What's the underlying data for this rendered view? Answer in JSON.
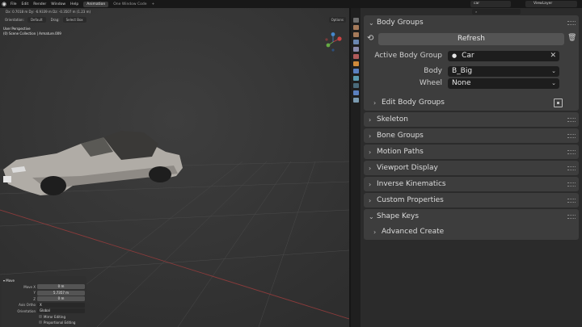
{
  "topbar": {
    "menus": [
      "File",
      "Edit",
      "Render",
      "Window",
      "Help"
    ],
    "workspace_tabs": [
      {
        "label": "Animation",
        "active": true
      },
      {
        "label": "One Window Code",
        "active": false
      }
    ],
    "scene_search": "car",
    "view_layer": "ViewLayer"
  },
  "viewport": {
    "status_text": "Dx: 0.7018 m   Dy: -6.9339 m   Dz: -0.3507 m (1.23 m)",
    "orientation_label": "Orientation:",
    "orientation_value": "Default",
    "drag_label": "Drag:",
    "drag_value": "Select Box",
    "options_label": "Options",
    "view_name": "User Perspective",
    "collection_info": "(0) Scene Collection | Armature.009"
  },
  "move_panel": {
    "title": "Move",
    "fields": [
      {
        "label": "Move X",
        "value": "0 m"
      },
      {
        "label": "Y",
        "value": "5.7357 m"
      },
      {
        "label": "Z",
        "value": "0 m"
      }
    ],
    "axis_ortho_label": "Axis Ortho",
    "axis_ortho_value": "X",
    "orientation_label": "Orientation",
    "orientation_value": "Global",
    "mirror_editing": "Mirror Editing",
    "proportional_editing": "Proportional Editing"
  },
  "properties": {
    "body_groups": {
      "title": "Body Groups",
      "refresh_label": "Refresh",
      "active_body_group_label": "Active Body Group",
      "active_body_group_value": "Car",
      "body_label": "Body",
      "body_value": "B_Big",
      "wheel_label": "Wheel",
      "wheel_value": "None",
      "edit_body_groups_label": "Edit Body Groups"
    },
    "panels": [
      {
        "title": "Skeleton"
      },
      {
        "title": "Bone Groups"
      },
      {
        "title": "Motion Paths"
      },
      {
        "title": "Viewport Display"
      },
      {
        "title": "Inverse Kinematics"
      },
      {
        "title": "Custom Properties"
      }
    ],
    "shape_keys": {
      "title": "Shape Keys",
      "advanced_create_label": "Advanced Create"
    }
  },
  "colors": {
    "viewport_bg": "#3a3a3a",
    "panel_bg": "#3d3d3d",
    "field_bg": "#1d1d1d",
    "button_bg": "#545454",
    "grid_red": "#8a3b3b"
  }
}
